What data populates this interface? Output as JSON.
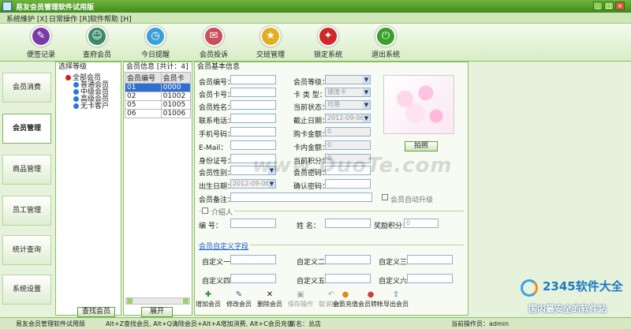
{
  "window": {
    "title": "易友会员管理软件试用版"
  },
  "menu": [
    "系统维护 [X]",
    "日常操作 [R]",
    "软件帮助 [H]"
  ],
  "toolbar": [
    {
      "label": "便签记录",
      "icon": "note-icon",
      "color": "#7a3aa8"
    },
    {
      "label": "查府会员",
      "icon": "member-icon",
      "color": "#3a8a6a"
    },
    {
      "label": "今日提醒",
      "icon": "reminder-icon",
      "color": "#3aa0d8"
    },
    {
      "label": "会员投诉",
      "icon": "complaint-icon",
      "color": "#c8505a"
    },
    {
      "label": "交班管理",
      "icon": "shift-icon",
      "color": "#e0b020"
    },
    {
      "label": "锁定系统",
      "icon": "lock-icon",
      "color": "#d02828"
    },
    {
      "label": "退出系统",
      "icon": "exit-icon",
      "color": "#3aa028"
    }
  ],
  "nav": [
    "会员消费",
    "会员管理",
    "商品管理",
    "员工管理",
    "统计查询",
    "系统设置"
  ],
  "grade_panel": {
    "title": "选择等级",
    "items": [
      "全部会员",
      "普通会员",
      "中级会员",
      "高级会员",
      "无卡客户"
    ],
    "button": "查找会员"
  },
  "list_panel": {
    "title": "会员信息 [共计：4]",
    "columns": [
      "会员编号",
      "会员卡"
    ],
    "rows": [
      [
        "01",
        "0000"
      ],
      [
        "02",
        "01002"
      ],
      [
        "05",
        "01005"
      ],
      [
        "06",
        "01006"
      ]
    ],
    "button": "展开"
  },
  "form": {
    "title": "会员基本信息",
    "labels": {
      "id": "会员编号：",
      "card": "会员卡号：",
      "name": "会员姓名：",
      "phone": "联系电话：",
      "mobile": "手机号码：",
      "email": "E-Mail：",
      "idcard": "身份证号：",
      "gender": "会员性别：",
      "birth": "出生日期：",
      "note": "会员备注：",
      "grade": "会员等级：",
      "cardtype": "卡 类 型：",
      "status": "当前状态：",
      "expire": "截止日期：",
      "buycard": "购卡金额：",
      "balance": "卡内金额：",
      "points": "当前积分：",
      "pwd": "会员密码：",
      "confirm": "确认密码："
    },
    "values": {
      "cardtype": "储值卡",
      "status": "可用",
      "expire": "2012-09-06",
      "birth": "2012-09-06",
      "buycard": "0",
      "balance": "0",
      "points": "0"
    },
    "photo_button": "拍照",
    "auto_upgrade": "会员自动升级",
    "referrer": {
      "title": "介绍人",
      "id_label": "编 号：",
      "name_label": "姓 名：",
      "points_label": "奖励积分：",
      "points_value": "0"
    },
    "custom": {
      "title": "会员自定义字段",
      "fields": [
        "自定义一：",
        "自定义二：",
        "自定义三：",
        "自定义四：",
        "自定义五：",
        "自定义六："
      ]
    }
  },
  "actions": [
    {
      "label": "增加会员",
      "icon": "add-icon",
      "glyph": "✚",
      "color": "#2a8a2a",
      "enabled": true
    },
    {
      "label": "修改会员",
      "icon": "edit-icon",
      "glyph": "✎",
      "color": "#335599",
      "enabled": true
    },
    {
      "label": "删除会员",
      "icon": "delete-icon",
      "glyph": "✕",
      "color": "#222222",
      "enabled": true
    },
    {
      "label": "保存操作",
      "icon": "save-icon",
      "glyph": "▣",
      "color": "#999999",
      "enabled": false
    },
    {
      "label": "取消操作",
      "icon": "cancel-icon",
      "glyph": "↶",
      "color": "#999999",
      "enabled": false
    },
    {
      "label": "会员充值",
      "icon": "recharge-icon",
      "glyph": "●",
      "color": "#e08a1a",
      "enabled": true
    },
    {
      "label": "会员转帐",
      "icon": "transfer-icon",
      "glyph": "●",
      "color": "#d04040",
      "enabled": true
    },
    {
      "label": "导出会员",
      "icon": "export-icon",
      "glyph": "⇪",
      "color": "#2a6ab0",
      "enabled": true
    }
  ],
  "status": {
    "app": "易友会员管理软件试用版",
    "shortcuts": "Alt+Z查找会员, Alt+Q清除会员+Alt+A增加消费, Alt+C会员充值",
    "store": "店名：总店",
    "operator": "当前操作员：admin"
  },
  "watermark": "www.DuoTe.com",
  "branding": {
    "name": "2345软件大全",
    "slogan": "国内最安全的软件站"
  }
}
